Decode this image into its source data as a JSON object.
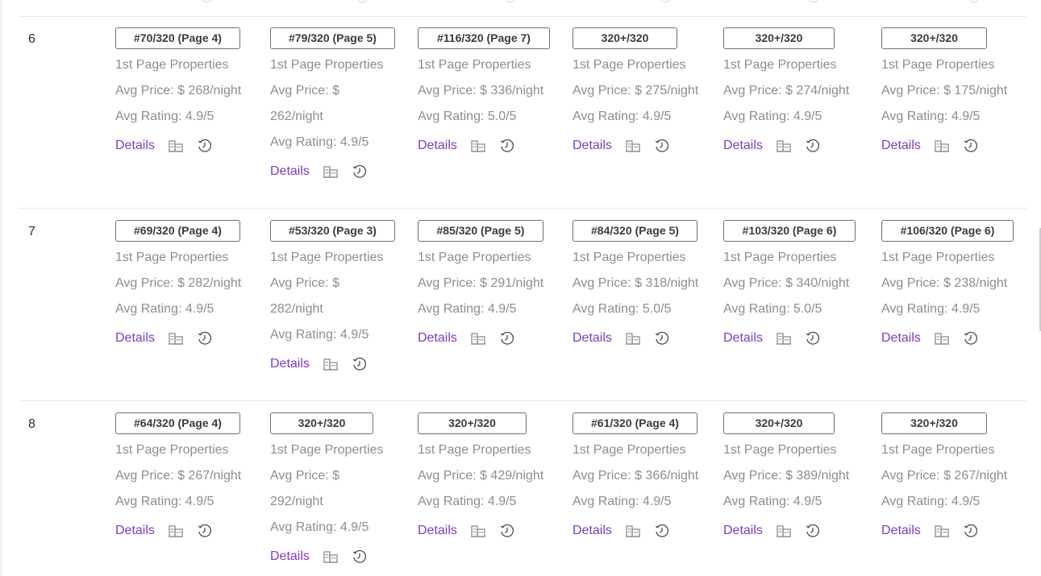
{
  "colors": {
    "link": "#7e3ac4",
    "muted": "#8c8c96",
    "badge_border": "#6e6e78"
  },
  "icons": {
    "building": "building-icon",
    "history": "history-icon"
  },
  "rows": [
    {
      "number": "6",
      "cells": [
        {
          "rank": "#70/320 (Page 4)",
          "properties": "1st Page Properties",
          "price": "Avg Price: $ 268/night",
          "rating": "Avg Rating: 4.9/5",
          "details": "Details"
        },
        {
          "rank": "#79/320 (Page 5)",
          "properties": "1st Page Properties",
          "price_lines": [
            "Avg Price: $",
            "262/night"
          ],
          "rating": "Avg Rating: 4.9/5",
          "details": "Details"
        },
        {
          "rank": "#116/320 (Page 7)",
          "properties": "1st Page Properties",
          "price": "Avg Price: $ 336/night",
          "rating": "Avg Rating: 5.0/5",
          "details": "Details"
        },
        {
          "rank": "320+/320",
          "properties": "1st Page Properties",
          "price": "Avg Price: $ 275/night",
          "rating": "Avg Rating: 4.9/5",
          "details": "Details"
        },
        {
          "rank": "320+/320",
          "properties": "1st Page Properties",
          "price": "Avg Price: $ 274/night",
          "rating": "Avg Rating: 4.9/5",
          "details": "Details"
        },
        {
          "rank": "320+/320",
          "properties": "1st Page Properties",
          "price": "Avg Price: $ 175/night",
          "rating": "Avg Rating: 4.9/5",
          "details": "Details"
        }
      ]
    },
    {
      "number": "7",
      "cells": [
        {
          "rank": "#69/320 (Page 4)",
          "properties": "1st Page Properties",
          "price": "Avg Price: $ 282/night",
          "rating": "Avg Rating: 4.9/5",
          "details": "Details"
        },
        {
          "rank": "#53/320 (Page 3)",
          "properties": "1st Page Properties",
          "price_lines": [
            "Avg Price: $",
            "282/night"
          ],
          "rating": "Avg Rating: 4.9/5",
          "details": "Details"
        },
        {
          "rank": "#85/320 (Page 5)",
          "properties": "1st Page Properties",
          "price": "Avg Price: $ 291/night",
          "rating": "Avg Rating: 4.9/5",
          "details": "Details"
        },
        {
          "rank": "#84/320 (Page 5)",
          "properties": "1st Page Properties",
          "price": "Avg Price: $ 318/night",
          "rating": "Avg Rating: 5.0/5",
          "details": "Details"
        },
        {
          "rank": "#103/320 (Page 6)",
          "properties": "1st Page Properties",
          "price": "Avg Price: $ 340/night",
          "rating": "Avg Rating: 5.0/5",
          "details": "Details"
        },
        {
          "rank": "#106/320 (Page 6)",
          "properties": "1st Page Properties",
          "price": "Avg Price: $ 238/night",
          "rating": "Avg Rating: 4.9/5",
          "details": "Details"
        }
      ]
    },
    {
      "number": "8",
      "cells": [
        {
          "rank": "#64/320 (Page 4)",
          "properties": "1st Page Properties",
          "price": "Avg Price: $ 267/night",
          "rating": "Avg Rating: 4.9/5",
          "details": "Details"
        },
        {
          "rank": "320+/320",
          "properties": "1st Page Properties",
          "price_lines": [
            "Avg Price: $",
            "292/night"
          ],
          "rating": "Avg Rating: 4.9/5",
          "details": "Details"
        },
        {
          "rank": "320+/320",
          "properties": "1st Page Properties",
          "price": "Avg Price: $ 429/night",
          "rating": "Avg Rating: 4.9/5",
          "details": "Details"
        },
        {
          "rank": "#61/320 (Page 4)",
          "properties": "1st Page Properties",
          "price": "Avg Price: $ 366/night",
          "rating": "Avg Rating: 4.9/5",
          "details": "Details"
        },
        {
          "rank": "320+/320",
          "properties": "1st Page Properties",
          "price": "Avg Price: $ 389/night",
          "rating": "Avg Rating: 4.9/5",
          "details": "Details"
        },
        {
          "rank": "320+/320",
          "properties": "1st Page Properties",
          "price": "Avg Price: $ 267/night",
          "rating": "Avg Rating: 4.9/5",
          "details": "Details"
        }
      ]
    }
  ]
}
